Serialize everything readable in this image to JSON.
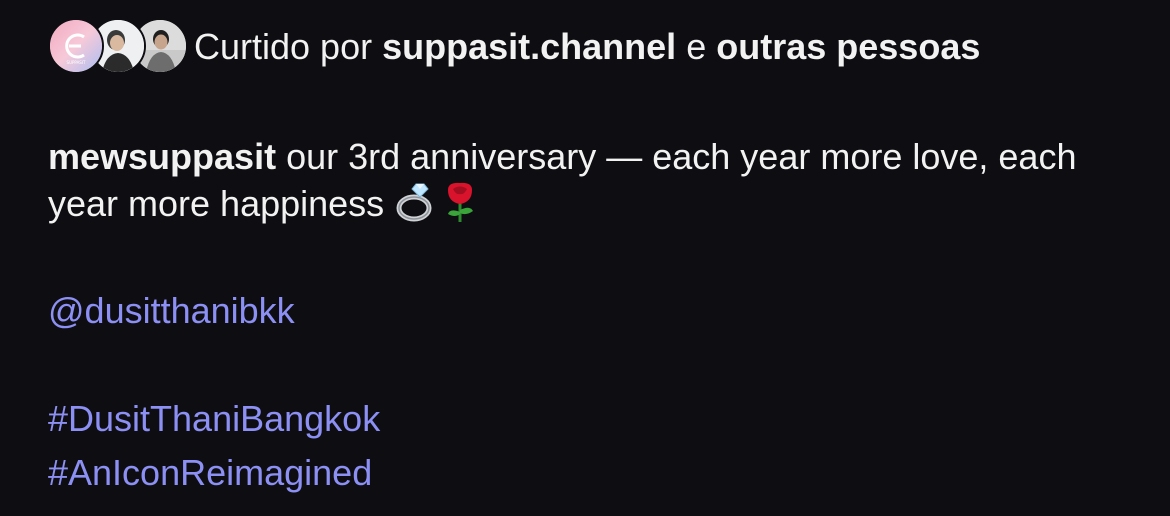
{
  "likes": {
    "prefix": "Curtido por",
    "user": "suppasit.channel",
    "connector": "e",
    "others": "outras pessoas",
    "avatars": [
      {
        "icon": "suppasit-logo-avatar",
        "bg": "#f4b6c6"
      },
      {
        "icon": "profile-photo-avatar",
        "bg": "#eef0f2"
      },
      {
        "icon": "profile-photo-avatar",
        "bg": "#e2e2e2"
      }
    ]
  },
  "post": {
    "username": "mewsuppasit",
    "caption": "our 3rd anniversary — each year more love, each year more happiness",
    "emojis": [
      "ring-emoji",
      "rose-emoji"
    ],
    "mention": "@dusitthanibkk",
    "hashtags": [
      "#DusitThaniBangkok",
      "#AnIconReimagined"
    ]
  },
  "colors": {
    "background": "#0e0e12",
    "text": "#f2f2f2",
    "link": "#8c8ff3"
  }
}
